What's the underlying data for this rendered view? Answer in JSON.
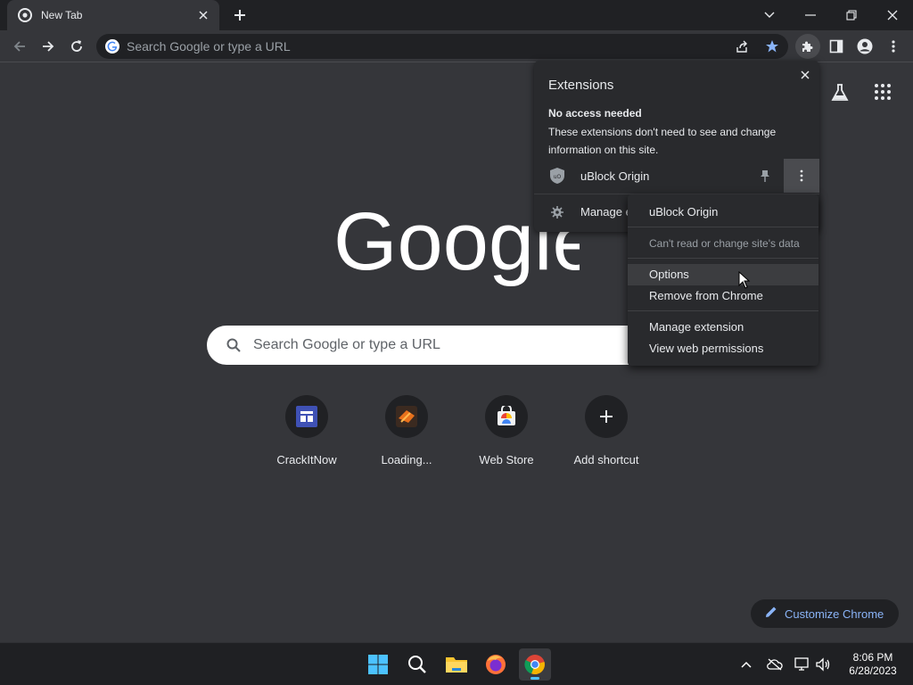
{
  "tab": {
    "title": "New Tab"
  },
  "toolbar": {
    "omnibox_placeholder": "Search Google or type a URL"
  },
  "ntp": {
    "logo_text": "Google",
    "search_placeholder": "Search Google or type a URL",
    "shortcuts": [
      {
        "label": "CrackItNow",
        "icon": "site-favicon",
        "color": "#3f51b5"
      },
      {
        "label": "Loading...",
        "icon": "loading-favicon",
        "color": "#e8711c"
      },
      {
        "label": "Web Store",
        "icon": "web-store-icon",
        "color": "#ea4335"
      },
      {
        "label": "Add shortcut",
        "icon": "plus-icon",
        "color": "#e8eaed"
      }
    ],
    "customize_label": "Customize Chrome"
  },
  "extensions_popup": {
    "title": "Extensions",
    "section_heading": "No access needed",
    "section_description": "These extensions don't need to see and change information on this site.",
    "extension_name": "uBlock Origin",
    "manage_label": "Manage e"
  },
  "context_menu": {
    "header": "uBlock Origin",
    "site_access": "Can't read or change site's data",
    "items": [
      "Options",
      "Remove from Chrome",
      "Manage extension",
      "View web permissions"
    ]
  },
  "taskbar": {
    "time": "8:06 PM",
    "date": "6/28/2023"
  },
  "colors": {
    "background": "#35363a",
    "titlebar": "#202124",
    "accent": "#8ab4f8",
    "star": "#8ab4f8"
  }
}
